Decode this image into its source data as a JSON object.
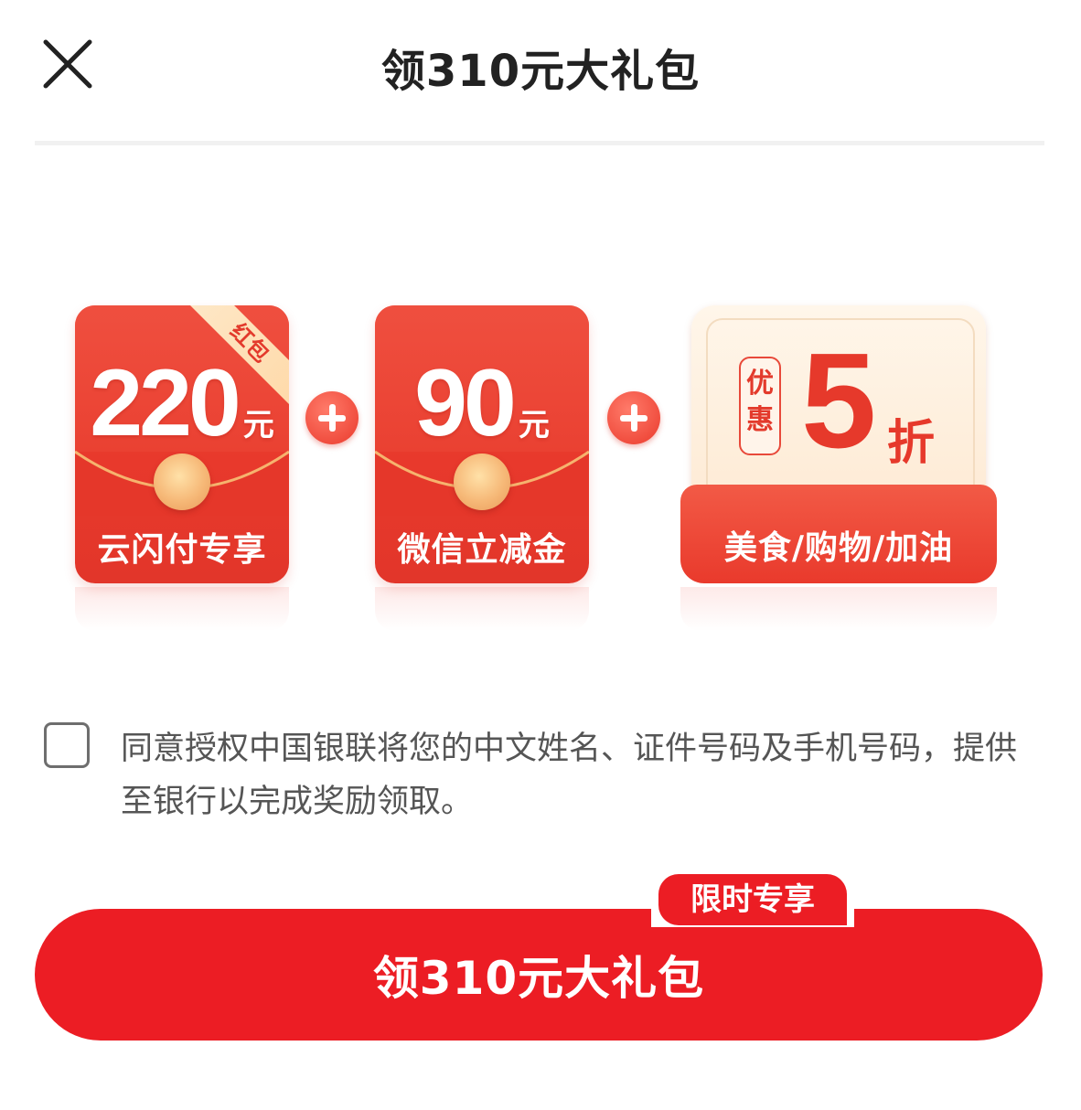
{
  "header": {
    "title": "领310元大礼包",
    "close_icon": "close-icon"
  },
  "offers": [
    {
      "amount": "220",
      "unit": "元",
      "label": "云闪付专享",
      "ribbon": "红包"
    },
    {
      "amount": "90",
      "unit": "元",
      "label": "微信立减金"
    },
    {
      "tag": "优惠",
      "value": "5",
      "unit": "折",
      "label": "美食/购物/加油"
    }
  ],
  "consent": {
    "checked": false,
    "text": "同意授权中国银联将您的中文姓名、证件号码及手机号码，提供至银行以完成奖励领取。"
  },
  "cta": {
    "label": "领310元大礼包",
    "badge": "限时专享"
  },
  "colors": {
    "brand_red": "#ec1d24",
    "packet_red": "#e8392c",
    "coupon_cream": "#fdf0e0"
  }
}
